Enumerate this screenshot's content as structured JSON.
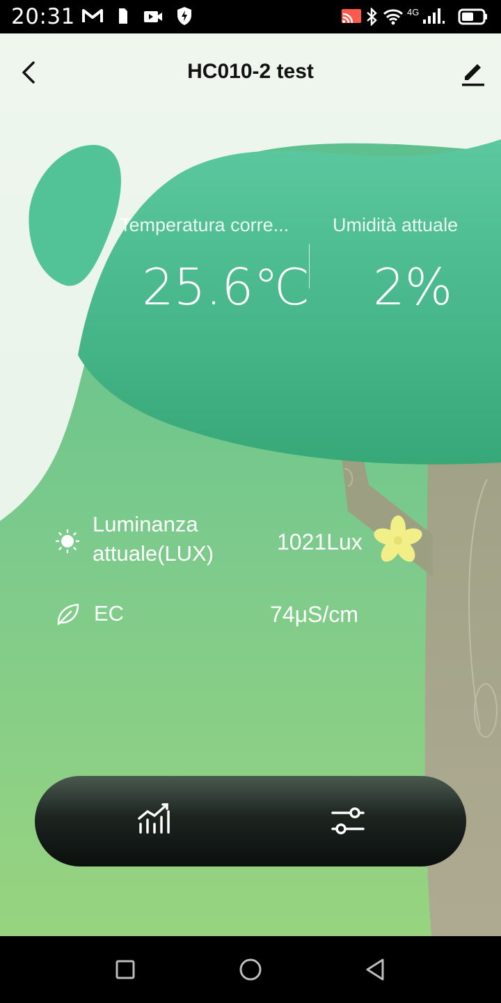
{
  "status_bar": {
    "time": "20:31",
    "network": "4G",
    "icons": [
      "gmail-icon",
      "sim-card-icon",
      "video-icon",
      "shield-icon",
      "cast-icon",
      "bluetooth-icon",
      "wifi-icon",
      "signal-icon",
      "battery-icon"
    ]
  },
  "header": {
    "title": "HC010-2 test",
    "back_icon": "chevron-left-icon",
    "edit_icon": "pencil-icon"
  },
  "metrics": {
    "temperature": {
      "label": "Temperatura corre...",
      "value": "25.6℃"
    },
    "humidity": {
      "label": "Umidità attuale",
      "value": "2%"
    }
  },
  "readings": [
    {
      "icon": "sun-icon",
      "label": "Luminanza attuale(LUX)",
      "value": "1021Lux"
    },
    {
      "icon": "leaf-icon",
      "label": "EC",
      "value": "74μS/cm"
    }
  ],
  "toolbar": {
    "items": [
      {
        "icon": "chart-icon"
      },
      {
        "icon": "sliders-icon"
      }
    ]
  },
  "nav_bar": {
    "items": [
      "recent-apps-icon",
      "home-icon",
      "back-triangle-icon"
    ]
  },
  "colors": {
    "canopy": "#4bbf95",
    "background_green": "#86cf8a",
    "trunk": "#a9a98e",
    "flower": "#f3f08a",
    "toolbar": "#1c2420"
  }
}
